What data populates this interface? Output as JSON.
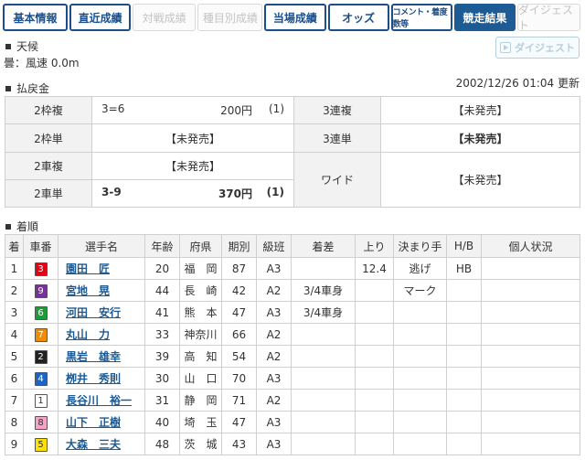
{
  "tabs": [
    {
      "label": "基本情報",
      "state": "active",
      "w": 72
    },
    {
      "label": "直近成績",
      "state": "active",
      "w": 68
    },
    {
      "label": "対戦成績",
      "state": "disabled",
      "w": 70
    },
    {
      "label": "種目別成績",
      "state": "disabled",
      "w": 72
    },
    {
      "label": "当場成績",
      "state": "active",
      "w": 68
    },
    {
      "label": "オッズ",
      "state": "active",
      "w": 68
    },
    {
      "label": "コメント・着度数等",
      "state": "active",
      "w": 68
    },
    {
      "label": "競走結果",
      "state": "selected",
      "w": 68
    },
    {
      "label": "ダイジェスト",
      "state": "disabled",
      "w": 70
    }
  ],
  "weather": {
    "heading": "天候",
    "value": "曇：風速 0.0m"
  },
  "digest_button": "ダイジェスト",
  "updated": "2002/12/26 01:04 更新",
  "payout": {
    "heading": "払戻金",
    "waku_fuku": {
      "label": "2枠複",
      "combo": "3=6",
      "amount": "200円",
      "pop": "(1)"
    },
    "renfuku3": {
      "label": "3連複",
      "value": "【未発売】"
    },
    "waku_tan": {
      "label": "2枠単",
      "value": "【未発売】"
    },
    "rentan3": {
      "label": "3連単",
      "value": "【未発売】"
    },
    "sha_fuku": {
      "label": "2車複",
      "value": "【未発売】"
    },
    "wide": {
      "label": "ワイド",
      "value": "【未発売】"
    },
    "sha_tan": {
      "label": "2車単",
      "combo": "3-9",
      "amount": "370円",
      "pop": "(1)"
    }
  },
  "results": {
    "heading": "着順",
    "headers": [
      "着",
      "車番",
      "選手名",
      "年齢",
      "府県",
      "期別",
      "級班",
      "着差",
      "上り",
      "決まり手",
      "H/B",
      "個人状況"
    ],
    "rows": [
      {
        "rank": "1",
        "car": "3",
        "name": "園田　匠",
        "age": "20",
        "pref": "福　岡",
        "term": "87",
        "class": "A3",
        "margin": "",
        "agari": "12.4",
        "kimarite": "逃げ",
        "hb": "HB",
        "status": ""
      },
      {
        "rank": "2",
        "car": "9",
        "name": "宮地　晃",
        "age": "44",
        "pref": "長　崎",
        "term": "42",
        "class": "A2",
        "margin": "3/4車身",
        "agari": "",
        "kimarite": "マーク",
        "hb": "",
        "status": ""
      },
      {
        "rank": "3",
        "car": "6",
        "name": "河田　安行",
        "age": "41",
        "pref": "熊　本",
        "term": "47",
        "class": "A3",
        "margin": "3/4車身",
        "agari": "",
        "kimarite": "",
        "hb": "",
        "status": ""
      },
      {
        "rank": "4",
        "car": "7",
        "name": "丸山　力",
        "age": "33",
        "pref": "神奈川",
        "term": "66",
        "class": "A2",
        "margin": "",
        "agari": "",
        "kimarite": "",
        "hb": "",
        "status": ""
      },
      {
        "rank": "5",
        "car": "2",
        "name": "黒岩　雄幸",
        "age": "39",
        "pref": "高　知",
        "term": "54",
        "class": "A2",
        "margin": "",
        "agari": "",
        "kimarite": "",
        "hb": "",
        "status": ""
      },
      {
        "rank": "6",
        "car": "4",
        "name": "栁井　秀則",
        "age": "30",
        "pref": "山　口",
        "term": "70",
        "class": "A3",
        "margin": "",
        "agari": "",
        "kimarite": "",
        "hb": "",
        "status": ""
      },
      {
        "rank": "7",
        "car": "1",
        "name": "長谷川　裕一",
        "age": "31",
        "pref": "静　岡",
        "term": "71",
        "class": "A2",
        "margin": "",
        "agari": "",
        "kimarite": "",
        "hb": "",
        "status": ""
      },
      {
        "rank": "8",
        "car": "8",
        "name": "山下　正樹",
        "age": "40",
        "pref": "埼　玉",
        "term": "47",
        "class": "A3",
        "margin": "",
        "agari": "",
        "kimarite": "",
        "hb": "",
        "status": ""
      },
      {
        "rank": "9",
        "car": "5",
        "name": "大森　三夫",
        "age": "48",
        "pref": "茨　城",
        "term": "43",
        "class": "A3",
        "margin": "",
        "agari": "",
        "kimarite": "",
        "hb": "",
        "status": ""
      }
    ]
  },
  "car_colors": {
    "1": {
      "bg": "#ffffff",
      "fg": "#333333"
    },
    "2": {
      "bg": "#222222",
      "fg": "#ffffff"
    },
    "3": {
      "bg": "#e60012",
      "fg": "#ffffff"
    },
    "4": {
      "bg": "#1d64c4",
      "fg": "#ffffff"
    },
    "5": {
      "bg": "#ffe100",
      "fg": "#333333"
    },
    "6": {
      "bg": "#1d9a3a",
      "fg": "#ffffff"
    },
    "7": {
      "bg": "#f08c00",
      "fg": "#ffffff"
    },
    "8": {
      "bg": "#f5a3c7",
      "fg": "#333333"
    },
    "9": {
      "bg": "#7a2f9a",
      "fg": "#ffffff"
    }
  }
}
